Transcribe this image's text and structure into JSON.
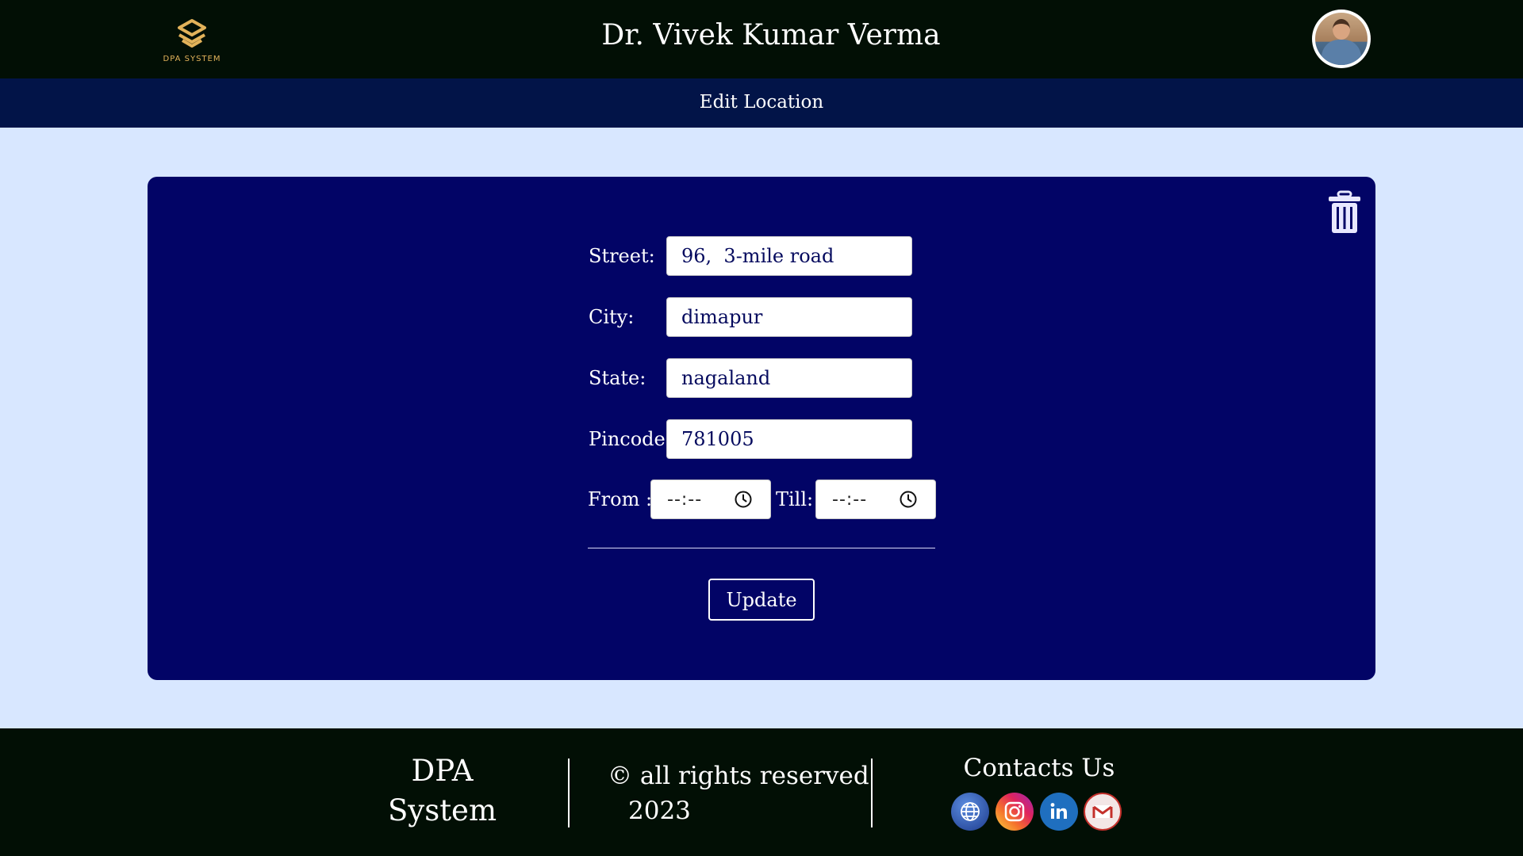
{
  "header": {
    "logo_text": "DPA SYSTEM",
    "doctor_name": "Dr. Vivek Kumar Verma",
    "avatar_icon": "doctor-avatar"
  },
  "subheader": {
    "title": "Edit Location"
  },
  "form": {
    "street_label": "Street:",
    "street_value": "96,  3-mile road",
    "city_label": "City:",
    "city_value": "dimapur",
    "state_label": "State:",
    "state_value": "nagaland",
    "pincode_label": "Pincode:",
    "pincode_value": "781005",
    "from_label": "From :",
    "from_value": "--:--",
    "till_label": "Till:",
    "till_value": "--:--",
    "update_label": "Update",
    "delete_icon": "trash-icon"
  },
  "footer": {
    "brand_line1": "DPA",
    "brand_line2": "System",
    "copyright_line1": "© all rights reserved",
    "copyright_line2": "2023",
    "contacts_title": "Contacts Us",
    "social_icons": [
      "globe-icon",
      "instagram-icon",
      "linkedin-icon",
      "gmail-icon"
    ]
  },
  "colors": {
    "header_bg": "#020f05",
    "subheader_bg": "#021448",
    "page_bg": "#d8e7ff",
    "card_bg": "#020466",
    "logo_gold": "#e2b25a"
  }
}
